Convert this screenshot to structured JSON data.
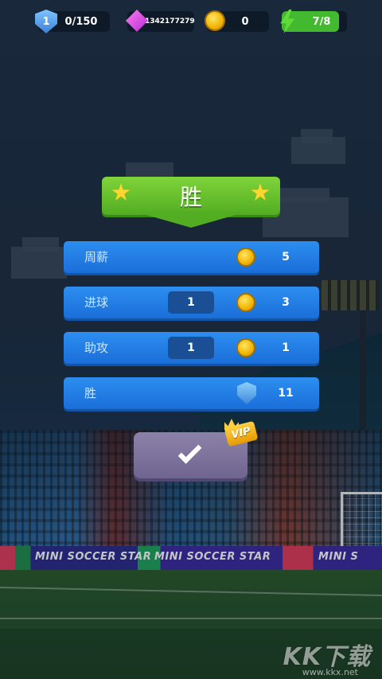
{
  "top_bar": {
    "level": "1",
    "level_progress": "0/150",
    "gems": "1342177279",
    "coins": "0",
    "energy": "7/8",
    "energy_fraction": 0.875
  },
  "result": {
    "title": "胜"
  },
  "rewards": [
    {
      "label": "周薪",
      "count": "",
      "icon": "coin-icon",
      "value": "5"
    },
    {
      "label": "进球",
      "count": "1",
      "icon": "coin-icon",
      "value": "3"
    },
    {
      "label": "助攻",
      "count": "1",
      "icon": "coin-icon",
      "value": "1"
    },
    {
      "label": "胜",
      "count": "",
      "icon": "shield-icon",
      "value": "11"
    }
  ],
  "confirm": {
    "vip_label": "VIP"
  },
  "ads": {
    "board_1": "MINI SOCCER STAR",
    "board_2": "MINI SOCCER STAR",
    "board_3": "MINI S"
  },
  "watermark": {
    "logo": "KK下载",
    "url": "www.kkx.net"
  },
  "colors": {
    "banner_green": "#6cc52e",
    "row_blue": "#2483e8",
    "energy_green": "#43b92f",
    "confirm_purple": "#7d7499"
  }
}
